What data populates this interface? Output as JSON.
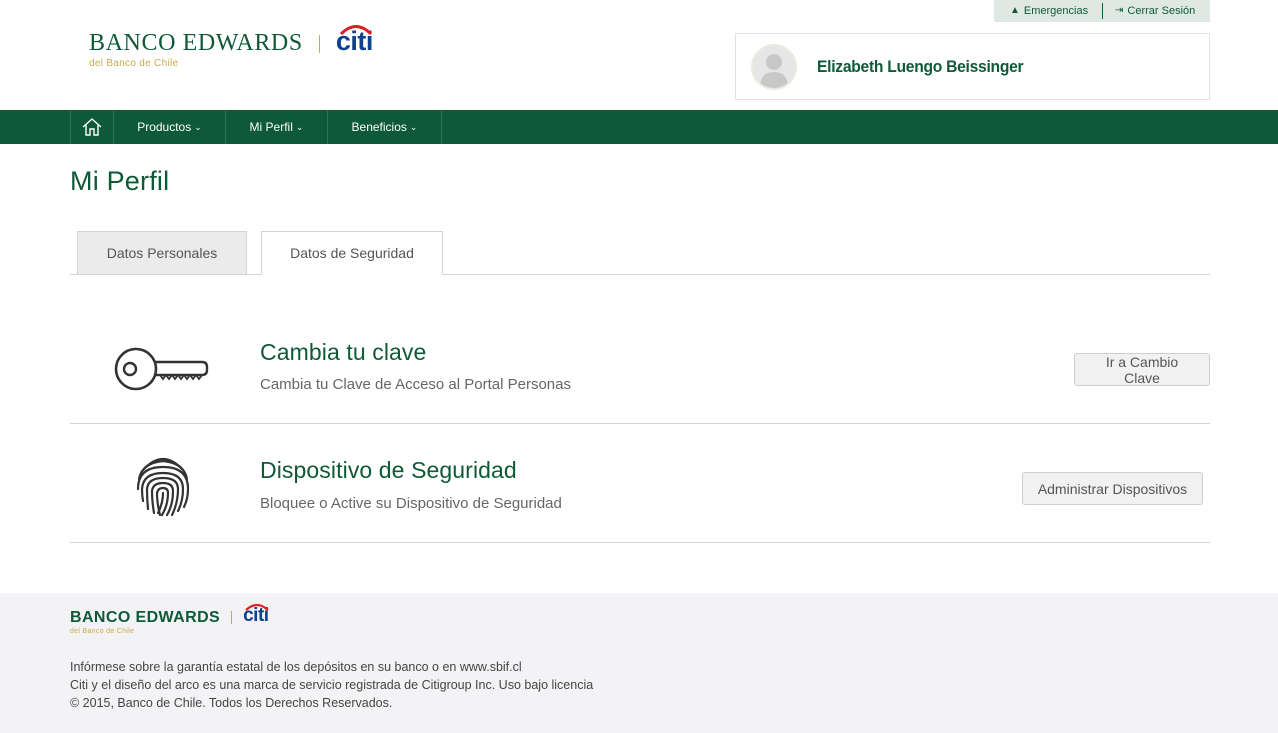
{
  "header": {
    "bank_name": "BANCO EDWARDS",
    "brand_citi": "citi",
    "bank_subtitle": "del Banco de Chile",
    "top_links": {
      "emergencias": "Emergencias",
      "cerrar_sesion": "Cerrar Sesión"
    },
    "user_name": "Elizabeth Luengo Beissinger"
  },
  "nav": {
    "items": [
      {
        "label": "Productos"
      },
      {
        "label": "Mi Perfil"
      },
      {
        "label": "Beneficios"
      }
    ]
  },
  "page": {
    "title": "Mi Perfil",
    "tabs": [
      {
        "label": "Datos Personales",
        "active": false
      },
      {
        "label": "Datos de Seguridad",
        "active": true
      }
    ]
  },
  "sections": [
    {
      "title": "Cambia tu clave",
      "description": "Cambia tu Clave de Acceso al Portal Personas",
      "button": "Ir a Cambio Clave",
      "icon": "key-icon"
    },
    {
      "title": "Dispositivo de Seguridad",
      "description": "Bloquee o Active su Dispositivo de Seguridad",
      "button": "Administrar Dispositivos",
      "icon": "fingerprint-icon"
    }
  ],
  "footer": {
    "bank_name": "BANCO EDWARDS",
    "brand_citi": "citi",
    "bank_subtitle": "del Banco de Chile",
    "lines": [
      "Infórmese sobre la garantía estatal de los depósitos en su banco o en www.sbif.cl",
      "Citi y el diseño del arco es una marca de servicio registrada de Citigroup Inc. Uso bajo licencia",
      "© 2015, Banco de Chile. Todos los Derechos Reservados."
    ]
  },
  "colors": {
    "brand_green": "#0e5a38",
    "gold": "#c9a94f",
    "citi_blue": "#0f3f8f",
    "citi_red": "#e31b23"
  }
}
